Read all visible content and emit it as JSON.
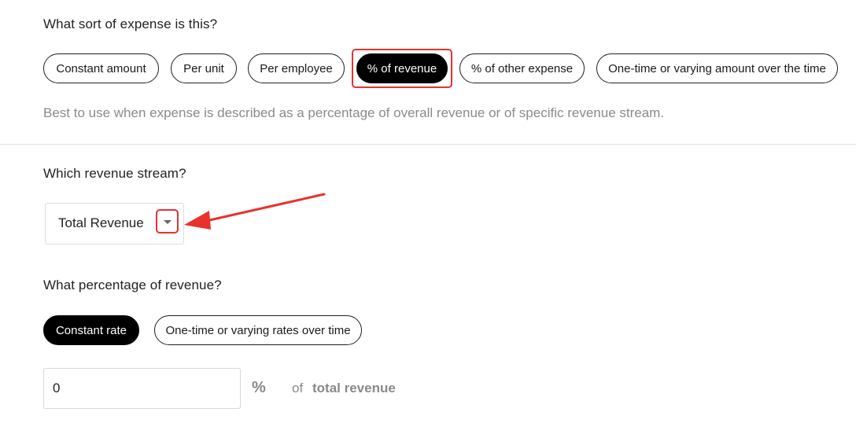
{
  "expense_type": {
    "question": "What sort of expense is this?",
    "options": [
      {
        "label": "Constant amount",
        "selected": false
      },
      {
        "label": "Per unit",
        "selected": false
      },
      {
        "label": "Per employee",
        "selected": false
      },
      {
        "label": "% of revenue",
        "selected": true
      },
      {
        "label": "% of other expense",
        "selected": false
      },
      {
        "label": "One-time or varying amount over the time",
        "selected": false
      }
    ],
    "helper_text": "Best to use when expense is described as a percentage of overall revenue or of specific revenue stream."
  },
  "revenue_stream": {
    "question": "Which revenue stream?",
    "selected_value": "Total Revenue",
    "caret_icon": "chevron-down-icon"
  },
  "percentage": {
    "question": "What percentage of revenue?",
    "rate_options": [
      {
        "label": "Constant rate",
        "selected": true
      },
      {
        "label": "One-time or varying rates over time",
        "selected": false
      }
    ],
    "input_value": "0",
    "percent_symbol": "%",
    "of_label": "of",
    "stream_label": "total revenue"
  },
  "colors": {
    "selected_pill": "#000000",
    "annotation_red": "#e8322e",
    "helper_gray": "#8a8a8a"
  }
}
